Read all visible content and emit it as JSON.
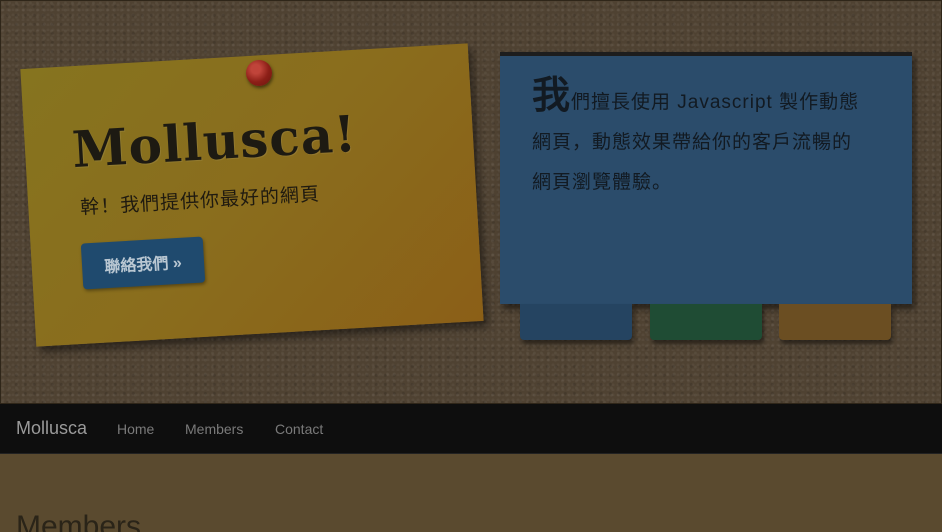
{
  "hero": {
    "title": "Mollusca!",
    "tagline": "幹！我們提供你最好的網頁",
    "contact_button": "聯絡我們 »",
    "panel": {
      "lead_char": "我",
      "text_line1": "們擅長使用 Javascript 製作動態",
      "text_line2": "網頁，動態效果帶給你的客戶流暢的",
      "text_line3": "網頁瀏覽體驗。"
    },
    "tab_colors": [
      "#254461",
      "#1f4c34",
      "#6b4e22"
    ]
  },
  "navbar": {
    "brand": "Mollusca",
    "links": [
      "Home",
      "Members",
      "Contact"
    ]
  },
  "content": {
    "heading": "Members"
  },
  "colors": {
    "note_yellow": "#8a6d1d",
    "panel_blue": "#2b4c6b",
    "navbar_bg": "#0e0e0e"
  }
}
